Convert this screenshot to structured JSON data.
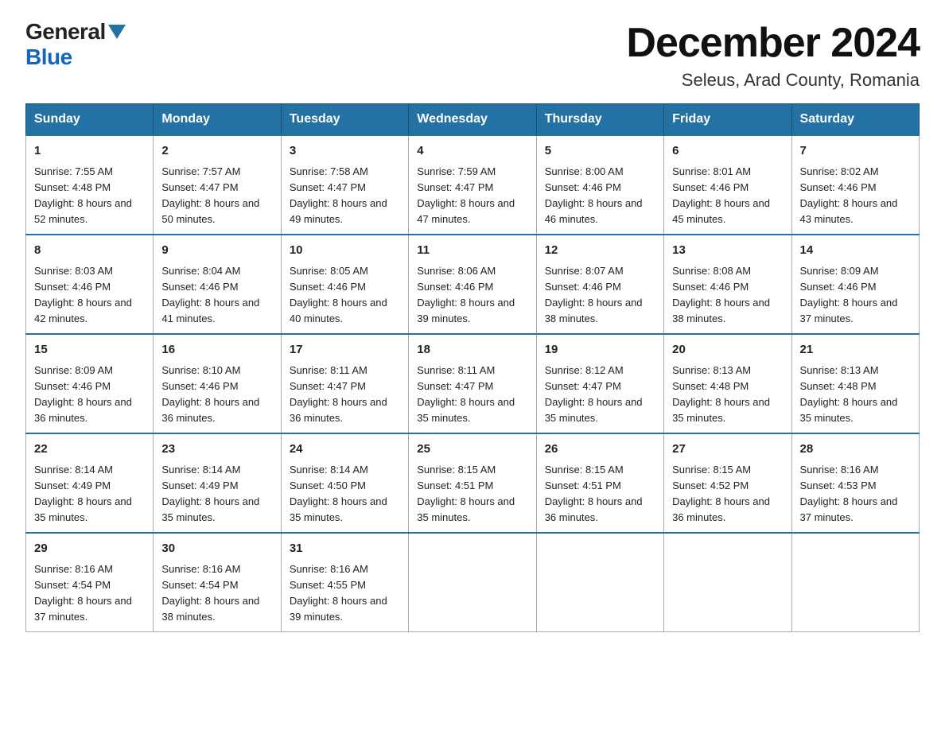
{
  "logo": {
    "general": "General",
    "blue": "Blue"
  },
  "title": "December 2024",
  "subtitle": "Seleus, Arad County, Romania",
  "days_of_week": [
    "Sunday",
    "Monday",
    "Tuesday",
    "Wednesday",
    "Thursday",
    "Friday",
    "Saturday"
  ],
  "weeks": [
    [
      {
        "day": "1",
        "sunrise": "7:55 AM",
        "sunset": "4:48 PM",
        "daylight": "8 hours and 52 minutes."
      },
      {
        "day": "2",
        "sunrise": "7:57 AM",
        "sunset": "4:47 PM",
        "daylight": "8 hours and 50 minutes."
      },
      {
        "day": "3",
        "sunrise": "7:58 AM",
        "sunset": "4:47 PM",
        "daylight": "8 hours and 49 minutes."
      },
      {
        "day": "4",
        "sunrise": "7:59 AM",
        "sunset": "4:47 PM",
        "daylight": "8 hours and 47 minutes."
      },
      {
        "day": "5",
        "sunrise": "8:00 AM",
        "sunset": "4:46 PM",
        "daylight": "8 hours and 46 minutes."
      },
      {
        "day": "6",
        "sunrise": "8:01 AM",
        "sunset": "4:46 PM",
        "daylight": "8 hours and 45 minutes."
      },
      {
        "day": "7",
        "sunrise": "8:02 AM",
        "sunset": "4:46 PM",
        "daylight": "8 hours and 43 minutes."
      }
    ],
    [
      {
        "day": "8",
        "sunrise": "8:03 AM",
        "sunset": "4:46 PM",
        "daylight": "8 hours and 42 minutes."
      },
      {
        "day": "9",
        "sunrise": "8:04 AM",
        "sunset": "4:46 PM",
        "daylight": "8 hours and 41 minutes."
      },
      {
        "day": "10",
        "sunrise": "8:05 AM",
        "sunset": "4:46 PM",
        "daylight": "8 hours and 40 minutes."
      },
      {
        "day": "11",
        "sunrise": "8:06 AM",
        "sunset": "4:46 PM",
        "daylight": "8 hours and 39 minutes."
      },
      {
        "day": "12",
        "sunrise": "8:07 AM",
        "sunset": "4:46 PM",
        "daylight": "8 hours and 38 minutes."
      },
      {
        "day": "13",
        "sunrise": "8:08 AM",
        "sunset": "4:46 PM",
        "daylight": "8 hours and 38 minutes."
      },
      {
        "day": "14",
        "sunrise": "8:09 AM",
        "sunset": "4:46 PM",
        "daylight": "8 hours and 37 minutes."
      }
    ],
    [
      {
        "day": "15",
        "sunrise": "8:09 AM",
        "sunset": "4:46 PM",
        "daylight": "8 hours and 36 minutes."
      },
      {
        "day": "16",
        "sunrise": "8:10 AM",
        "sunset": "4:46 PM",
        "daylight": "8 hours and 36 minutes."
      },
      {
        "day": "17",
        "sunrise": "8:11 AM",
        "sunset": "4:47 PM",
        "daylight": "8 hours and 36 minutes."
      },
      {
        "day": "18",
        "sunrise": "8:11 AM",
        "sunset": "4:47 PM",
        "daylight": "8 hours and 35 minutes."
      },
      {
        "day": "19",
        "sunrise": "8:12 AM",
        "sunset": "4:47 PM",
        "daylight": "8 hours and 35 minutes."
      },
      {
        "day": "20",
        "sunrise": "8:13 AM",
        "sunset": "4:48 PM",
        "daylight": "8 hours and 35 minutes."
      },
      {
        "day": "21",
        "sunrise": "8:13 AM",
        "sunset": "4:48 PM",
        "daylight": "8 hours and 35 minutes."
      }
    ],
    [
      {
        "day": "22",
        "sunrise": "8:14 AM",
        "sunset": "4:49 PM",
        "daylight": "8 hours and 35 minutes."
      },
      {
        "day": "23",
        "sunrise": "8:14 AM",
        "sunset": "4:49 PM",
        "daylight": "8 hours and 35 minutes."
      },
      {
        "day": "24",
        "sunrise": "8:14 AM",
        "sunset": "4:50 PM",
        "daylight": "8 hours and 35 minutes."
      },
      {
        "day": "25",
        "sunrise": "8:15 AM",
        "sunset": "4:51 PM",
        "daylight": "8 hours and 35 minutes."
      },
      {
        "day": "26",
        "sunrise": "8:15 AM",
        "sunset": "4:51 PM",
        "daylight": "8 hours and 36 minutes."
      },
      {
        "day": "27",
        "sunrise": "8:15 AM",
        "sunset": "4:52 PM",
        "daylight": "8 hours and 36 minutes."
      },
      {
        "day": "28",
        "sunrise": "8:16 AM",
        "sunset": "4:53 PM",
        "daylight": "8 hours and 37 minutes."
      }
    ],
    [
      {
        "day": "29",
        "sunrise": "8:16 AM",
        "sunset": "4:54 PM",
        "daylight": "8 hours and 37 minutes."
      },
      {
        "day": "30",
        "sunrise": "8:16 AM",
        "sunset": "4:54 PM",
        "daylight": "8 hours and 38 minutes."
      },
      {
        "day": "31",
        "sunrise": "8:16 AM",
        "sunset": "4:55 PM",
        "daylight": "8 hours and 39 minutes."
      },
      null,
      null,
      null,
      null
    ]
  ]
}
